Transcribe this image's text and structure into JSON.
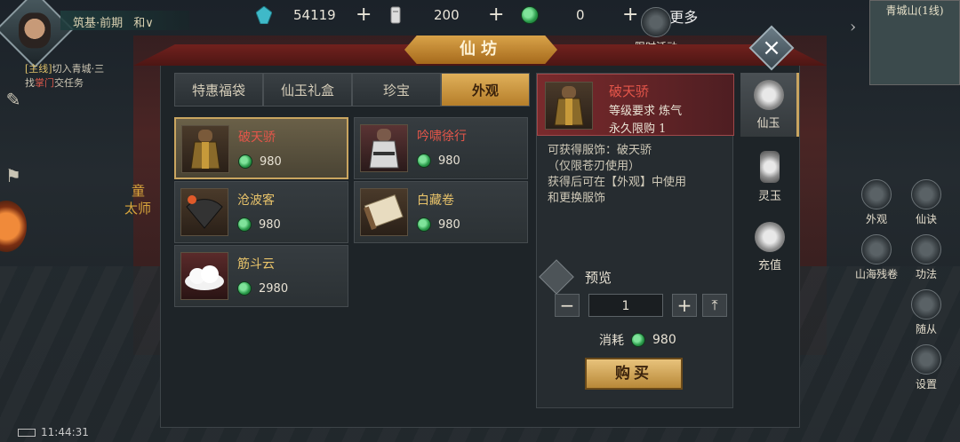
{
  "hud": {
    "player_rank": "筑基·前期",
    "player_extra": "和∨",
    "quest_tag": "[主线]",
    "quest_text_1": "切入青城·三",
    "quest_text_2a": "找",
    "quest_text_2hl": "掌门",
    "quest_text_2b": "交任务",
    "world_text_1": "童",
    "world_text_2": "太师",
    "clock": "11:44:31",
    "currency": [
      {
        "icon": "crystal-icon",
        "value": "54119"
      },
      {
        "icon": "token-icon",
        "value": "200"
      },
      {
        "icon": "jade-icon",
        "value": "0"
      }
    ],
    "more_label": "更多",
    "minimap_title": "青城山(1线)",
    "right_buttons": [
      {
        "label": "限时活动"
      },
      {
        "label": "外观"
      },
      {
        "label": "仙诀"
      },
      {
        "label": "山海残卷"
      },
      {
        "label": "功法"
      },
      {
        "label": "随从"
      },
      {
        "label": "设置"
      }
    ]
  },
  "dialog": {
    "title": "仙坊",
    "tabs": [
      {
        "label": "特惠福袋",
        "active": false
      },
      {
        "label": "仙玉礼盒",
        "active": false
      },
      {
        "label": "珍宝",
        "active": false
      },
      {
        "label": "外观",
        "active": true
      }
    ],
    "items": [
      {
        "name": "破天骄",
        "price": "980",
        "selected": true
      },
      {
        "name": "吟啸徐行",
        "price": "980",
        "selected": false
      },
      {
        "name": "沧波客",
        "price": "980",
        "selected": false
      },
      {
        "name": "白藏卷",
        "price": "980",
        "selected": false
      },
      {
        "name": "筋斗云",
        "price": "2980",
        "selected": false
      }
    ],
    "detail": {
      "name": "破天骄",
      "requirement": "等级要求  炼气",
      "limit": "永久限购  1",
      "desc_1": "可获得服饰：破天骄",
      "desc_2": "（仅限苍刃使用）",
      "desc_3": "获得后可在【外观】中使用",
      "desc_4": "和更换服饰",
      "preview_label": "预览",
      "quantity": "1",
      "cost_label": "消耗",
      "cost_value": "980",
      "buy_label": "购买"
    },
    "side_tabs": [
      {
        "label": "仙玉",
        "active": true
      },
      {
        "label": "灵玉",
        "active": false
      },
      {
        "label": "充值",
        "active": false
      }
    ]
  }
}
